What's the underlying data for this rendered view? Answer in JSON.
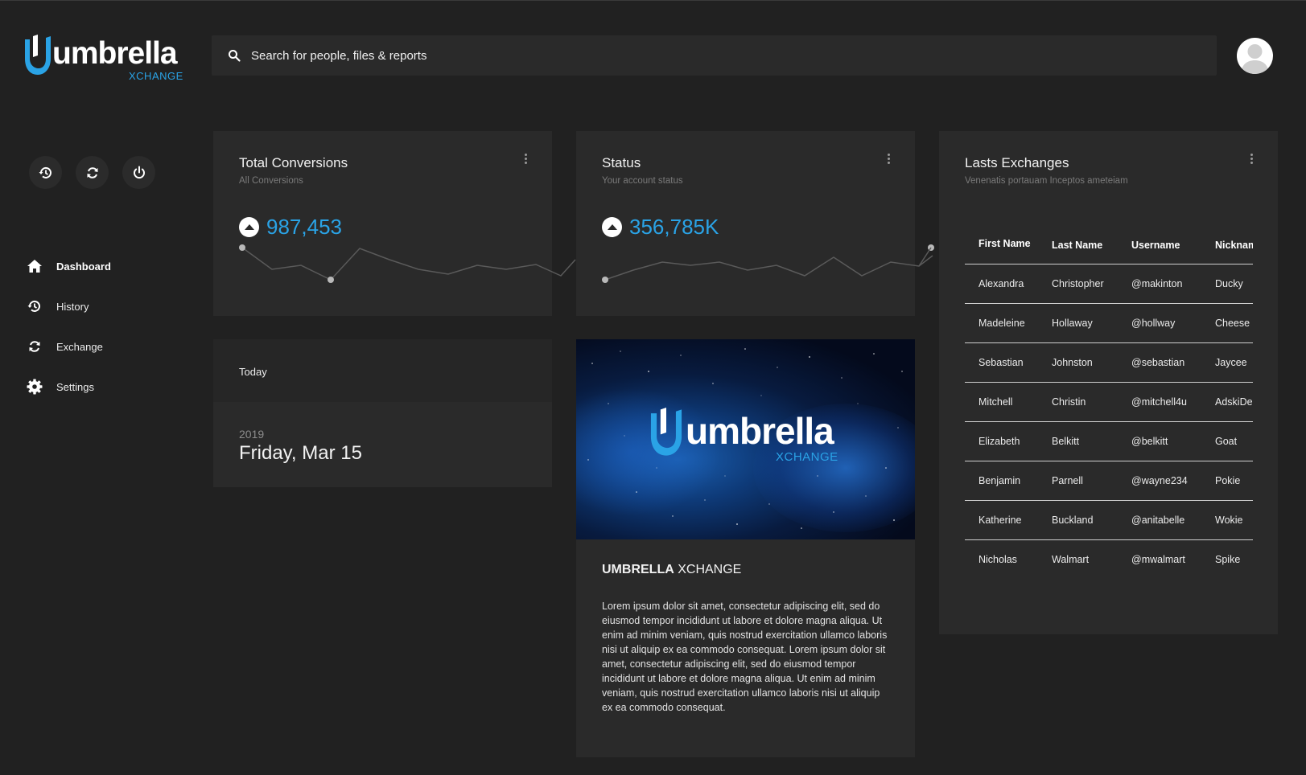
{
  "brand": {
    "name": "umbrella",
    "suffix": "XCHANGE",
    "accent": "#2aa3e6"
  },
  "search": {
    "placeholder": "Search for people, files & reports",
    "icon": "search-icon"
  },
  "quick_actions": [
    {
      "name": "history-icon"
    },
    {
      "name": "refresh-icon"
    },
    {
      "name": "power-icon"
    }
  ],
  "sidebar": {
    "items": [
      {
        "label": "Dashboard",
        "icon": "home-icon",
        "active": true
      },
      {
        "label": "History",
        "icon": "history-icon",
        "active": false
      },
      {
        "label": "Exchange",
        "icon": "exchange-icon",
        "active": false
      },
      {
        "label": "Settings",
        "icon": "gear-icon",
        "active": false
      }
    ]
  },
  "conversions": {
    "title": "Total Conversions",
    "subtitle": "All Conversions",
    "value": "987,453"
  },
  "status": {
    "title": "Status",
    "subtitle": "Your account status",
    "value": "356,785K"
  },
  "today": {
    "label": "Today",
    "year": "2019",
    "date": "Friday, Mar 15"
  },
  "promo": {
    "heading_bold": "UMBRELLA",
    "heading_rest": " XCHANGE",
    "body": "Lorem ipsum dolor sit amet, consectetur adipiscing elit, sed do eiusmod tempor incididunt ut labore et dolore magna aliqua. Ut enim ad minim veniam, quis nostrud exercitation ullamco laboris nisi ut aliquip ex ea commodo consequat. Lorem ipsum dolor sit amet, consectetur adipiscing elit, sed do eiusmod tempor incididunt ut labore et dolore magna aliqua. Ut enim ad minim veniam, quis nostrud exercitation ullamco laboris nisi ut aliquip ex ea commodo consequat."
  },
  "exchanges": {
    "title": "Lasts Exchanges",
    "subtitle": "Venenatis portauam Inceptos ameteiam",
    "columns": [
      "First Name",
      "Last Name",
      "Username",
      "Nickname"
    ],
    "rows": [
      [
        "Alexandra",
        "Christopher",
        "@makinton",
        "Ducky"
      ],
      [
        "Madeleine",
        "Hollaway",
        "@hollway",
        "Cheese"
      ],
      [
        "Sebastian",
        "Johnston",
        "@sebastian",
        "Jaycee"
      ],
      [
        "Mitchell",
        "Christin",
        "@mitchell4u",
        "AdskiDeer"
      ],
      [
        "Elizabeth",
        "Belkitt",
        "@belkitt",
        "Goat"
      ],
      [
        "Benjamin",
        "Parnell",
        "@wayne234",
        "Pokie"
      ],
      [
        "Katherine",
        "Buckland",
        "@anitabelle",
        "Wokie"
      ],
      [
        "Nicholas",
        "Walmart",
        "@mwalmart",
        "Spike"
      ]
    ]
  }
}
